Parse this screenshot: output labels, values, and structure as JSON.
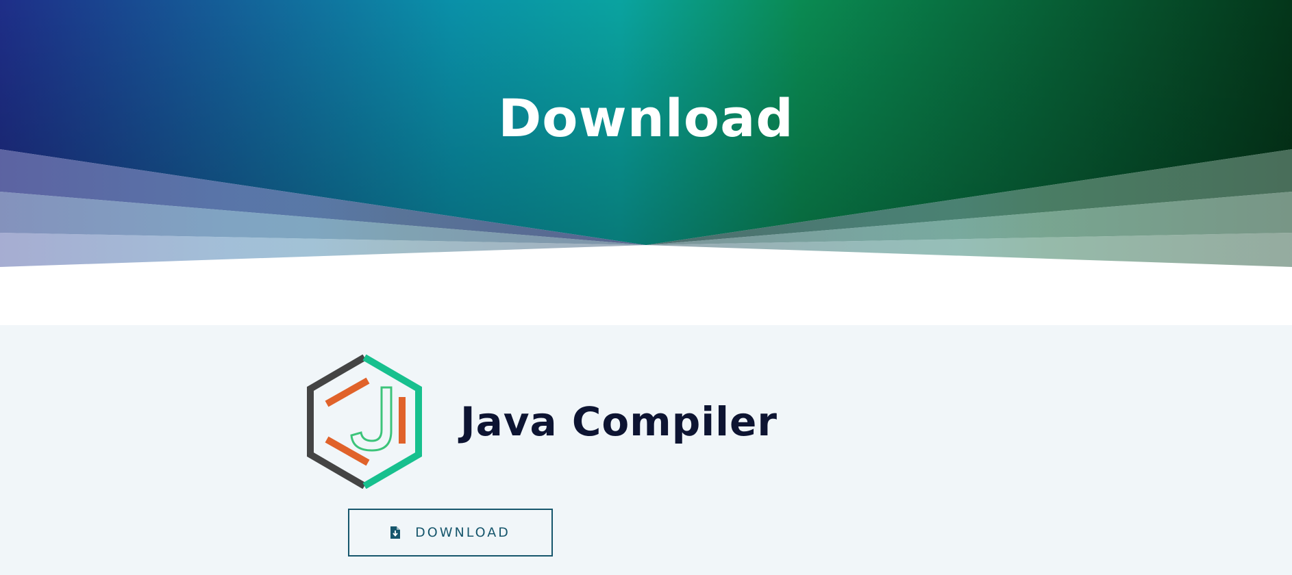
{
  "hero": {
    "title": "Download"
  },
  "product": {
    "name": "Java Compiler",
    "download_button_label": "DOWNLOAD"
  },
  "colors": {
    "hero_gradient": [
      "#1e2e88",
      "#0a9aa8",
      "#0a8a50",
      "#053d1a"
    ],
    "panel_background": "#f1f6f9",
    "title_text": "#0d1432",
    "button_border": "#16566c",
    "logo_dark": "#444444",
    "logo_teal": "#17c08e",
    "logo_orange": "#e0622a",
    "logo_green": "#3cc47a"
  },
  "icons": {
    "download_icon": "file-download-icon"
  }
}
